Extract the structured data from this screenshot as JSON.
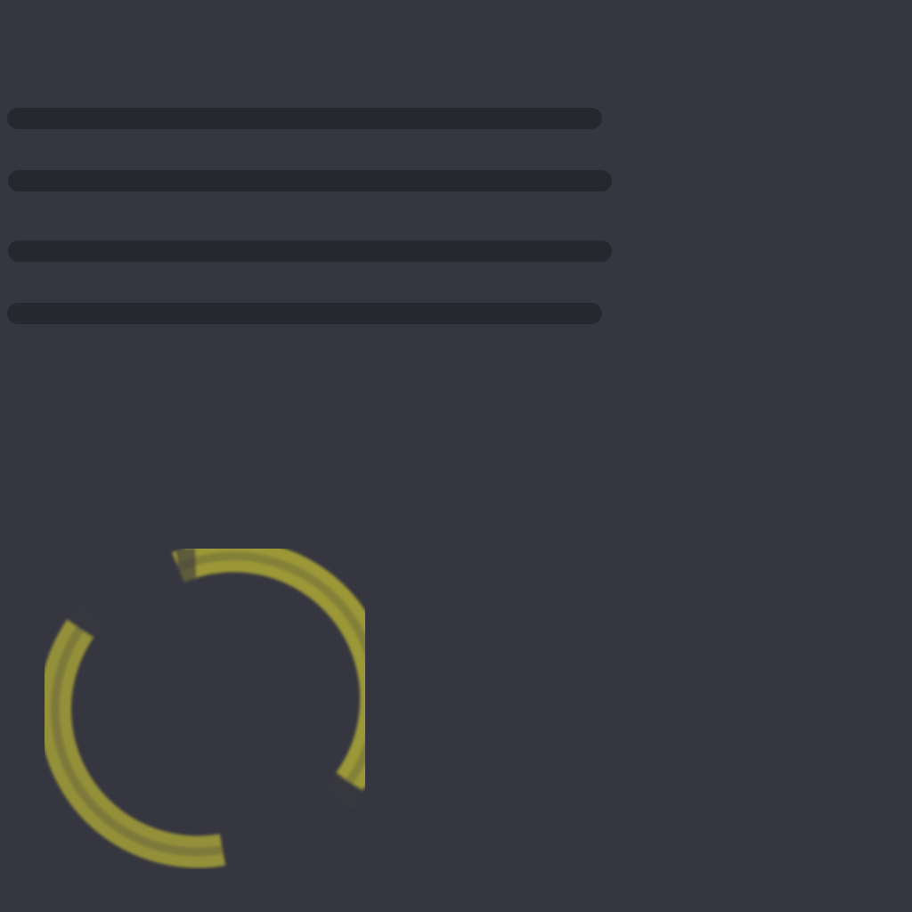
{
  "loading": {
    "state": "loading",
    "skeleton_line_count": 4,
    "spinner": {
      "icon": "spinner-icon",
      "color": "#b8b336",
      "background": "#363640"
    }
  },
  "colors": {
    "background": "#363640",
    "skeleton": "#27272f",
    "accent": "#b8b336"
  }
}
